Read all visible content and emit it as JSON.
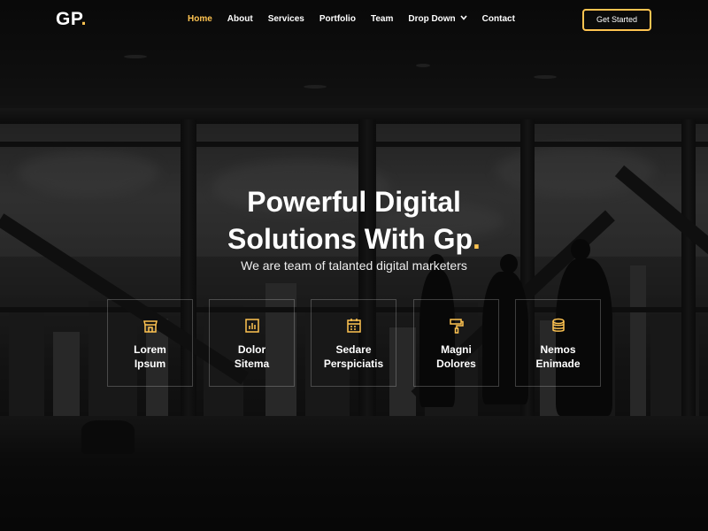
{
  "brand": {
    "name": "GP",
    "dot": "."
  },
  "nav": {
    "items": [
      "Home",
      "About",
      "Services",
      "Portfolio",
      "Team",
      "Drop Down",
      "Contact"
    ],
    "active": "Home"
  },
  "cta_label": "Get Started",
  "hero": {
    "title_line1": "Powerful Digital",
    "title_line2": "Solutions With Gp",
    "title_dot": ".",
    "subtitle": "We are team of talanted digital marketers"
  },
  "features": [
    {
      "icon": "store-icon",
      "line1": "Lorem",
      "line2": "Ipsum"
    },
    {
      "icon": "bar-chart-icon",
      "line1": "Dolor",
      "line2": "Sitema"
    },
    {
      "icon": "calendar-icon",
      "line1": "Sedare",
      "line2": "Perspiciatis"
    },
    {
      "icon": "paint-roller-icon",
      "line1": "Magni",
      "line2": "Dolores"
    },
    {
      "icon": "database-icon",
      "line1": "Nemos",
      "line2": "Enimade"
    }
  ],
  "colors": {
    "accent": "#ffc451",
    "background": "#0b0b0b",
    "text": "#ffffff"
  }
}
